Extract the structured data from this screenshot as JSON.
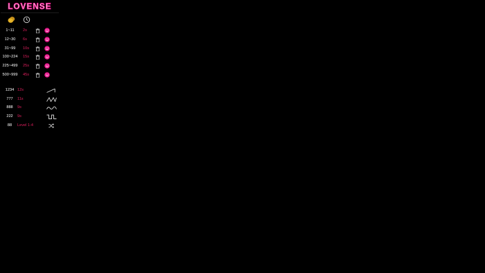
{
  "brand": {
    "name": "LOVENSE",
    "color": "#e9168c"
  },
  "header": {
    "icons": [
      "coins-icon",
      "clock-icon"
    ]
  },
  "tip_levels": [
    {
      "range": "1~11",
      "duration": "2s",
      "icon": "face-icon"
    },
    {
      "range": "12~30",
      "duration": "6s",
      "icon": "face-icon"
    },
    {
      "range": "31~99",
      "duration": "10s",
      "icon": "face-icon"
    },
    {
      "range": "100~224",
      "duration": "15s",
      "icon": "face-icon"
    },
    {
      "range": "225~499",
      "duration": "25s",
      "icon": "face-icon"
    },
    {
      "range": "500~999",
      "duration": "45s",
      "icon": "face-icon"
    }
  ],
  "special_commands": [
    {
      "code": "1234",
      "duration": "12s",
      "icon": "pattern-ramp-icon"
    },
    {
      "code": "777",
      "duration": "11s",
      "icon": "pattern-sawtooth-icon"
    },
    {
      "code": "888",
      "duration": "9s",
      "icon": "pattern-wave-icon"
    },
    {
      "code": "222",
      "duration": "9s",
      "icon": "pattern-pulse-icon"
    },
    {
      "code": "88",
      "duration": "Level 1-4",
      "icon": "shuffle-icon"
    }
  ],
  "colors": {
    "background": "#000000",
    "text": "#ffffff",
    "accent": "#e01f5e",
    "face": "#e9168c",
    "icon": "#bdbdbd"
  }
}
